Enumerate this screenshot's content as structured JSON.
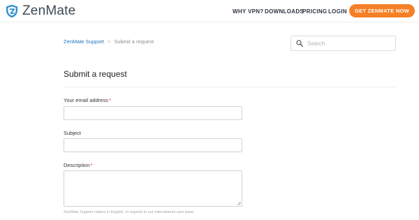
{
  "header": {
    "brand": "ZenMate",
    "nav": {
      "why_vpn": "WHY VPN?",
      "downloads": "DOWNLOADS",
      "pricing": "PRICING",
      "login": "LOGIN"
    },
    "cta": "GET ZENMATE NOW"
  },
  "breadcrumb": {
    "home": "ZenMate Support",
    "separator": ">",
    "current": "Submit a request"
  },
  "search": {
    "placeholder": "Search",
    "icon": "search-icon"
  },
  "form": {
    "title": "Submit a request",
    "email_label": "Your email address",
    "subject_label": "Subject",
    "description_label": "Description",
    "required_mark": "*",
    "email_value": "",
    "subject_value": "",
    "description_value": "",
    "hint": "ZenMate Support replies in English, in regards to our international user base."
  },
  "colors": {
    "accent": "#f58025",
    "brand": "#3d4a57",
    "link": "#1f73b7",
    "required": "#e0252a"
  }
}
